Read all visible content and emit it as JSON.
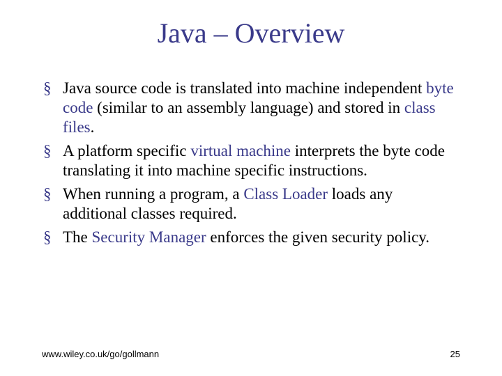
{
  "title": "Java – Overview",
  "bullets": [
    {
      "pre": "Java source code is translated into machine independent ",
      "term": "byte code",
      "mid": " (similar to an assembly language) and stored in ",
      "term2": "class files",
      "post": "."
    },
    {
      "pre": "A platform specific ",
      "term": "virtual machine",
      "mid": " interprets the byte code translating it into machine specific instructions.",
      "term2": "",
      "post": ""
    },
    {
      "pre": "When running a program, a ",
      "term": "Class Loader",
      "mid": " loads any additional classes required.",
      "term2": "",
      "post": ""
    },
    {
      "pre": "The ",
      "term": "Security Manager",
      "mid": " enforces the given security policy.",
      "term2": "",
      "post": ""
    }
  ],
  "footer": {
    "url": "www.wiley.co.uk/go/gollmann",
    "page": "25"
  }
}
